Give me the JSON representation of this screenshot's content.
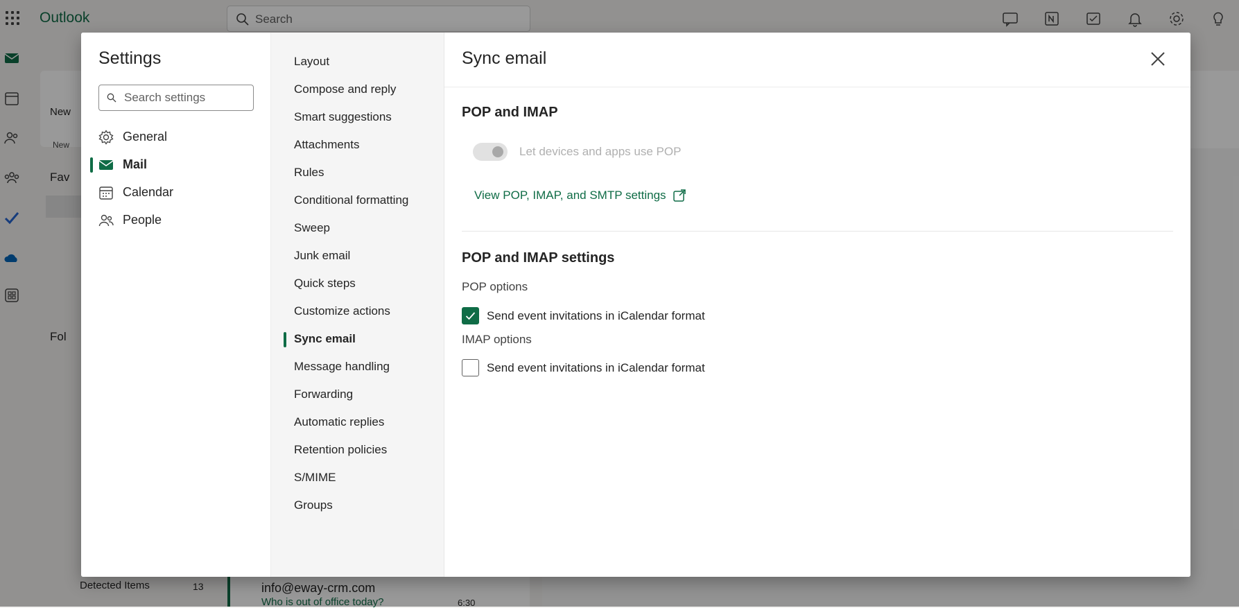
{
  "app": {
    "name": "Outlook",
    "search_placeholder": "Search"
  },
  "background": {
    "new_label": "New",
    "new_group_label": "New",
    "favorites_label": "Fav",
    "folders_label": "Fol",
    "detected_items_label": "Detected Items",
    "detected_items_count": "13",
    "message_sender": "info@eway-crm.com",
    "message_subject": "Who is out of office today?",
    "message_time": "6:30"
  },
  "settings": {
    "title": "Settings",
    "search_placeholder": "Search settings",
    "categories": [
      {
        "label": "General",
        "icon": "gear-icon",
        "active": false
      },
      {
        "label": "Mail",
        "icon": "mail-icon",
        "active": true
      },
      {
        "label": "Calendar",
        "icon": "calendar-icon",
        "active": false
      },
      {
        "label": "People",
        "icon": "people-icon",
        "active": false
      }
    ],
    "subcategories": [
      "Layout",
      "Compose and reply",
      "Smart suggestions",
      "Attachments",
      "Rules",
      "Conditional formatting",
      "Sweep",
      "Junk email",
      "Quick steps",
      "Customize actions",
      "Sync email",
      "Message handling",
      "Forwarding",
      "Automatic replies",
      "Retention policies",
      "S/MIME",
      "Groups"
    ],
    "active_subcategory": "Sync email"
  },
  "page": {
    "title": "Sync email",
    "pop_imap": {
      "title": "POP and IMAP",
      "toggle_label": "Let devices and apps use POP",
      "toggle_on": false,
      "link_label": "View POP, IMAP, and SMTP settings"
    },
    "pop_imap_settings": {
      "title": "POP and IMAP settings",
      "pop_options_label": "POP options",
      "pop_checkbox_label": "Send event invitations in iCalendar format",
      "pop_checked": true,
      "imap_options_label": "IMAP options",
      "imap_checkbox_label": "Send event invitations in iCalendar format",
      "imap_checked": false
    }
  },
  "colors": {
    "accent": "#0f6c46",
    "text": "#242424",
    "disabled": "#b0b0b0"
  }
}
